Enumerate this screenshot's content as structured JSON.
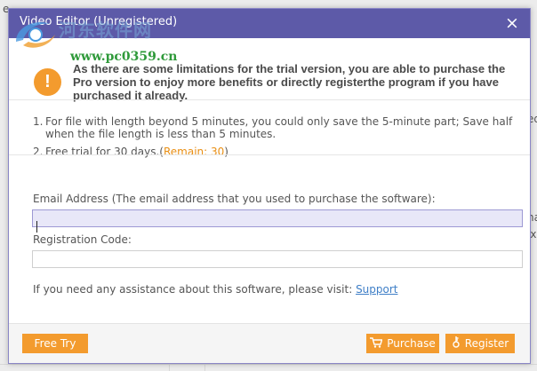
{
  "background": {
    "fragments": [
      "e",
      "ed",
      "na",
      "lx"
    ]
  },
  "dialog": {
    "title": "Video Editor (Unregistered)",
    "close_label": "×",
    "watermark": {
      "cn_text": "河东软件网",
      "url": "www.pc0359.cn"
    },
    "notice": "As there are some limitations for the trial version, you are able to purchase the Pro version to enjoy more benefits or directly registerthe program if you have purchased it already.",
    "notice_icon": "!",
    "limits": [
      {
        "num": "1.",
        "text": "For file with length beyond 5 minutes, you could only save the 5-minute part; Save half when the file length is less than 5 minutes."
      },
      {
        "num": "2.",
        "text": "Free trial for 30 days.",
        "remain_open": "(",
        "remain_label": "Remain: 30",
        "remain_close": ")"
      }
    ],
    "email": {
      "label": "Email Address (The email address that you used to purchase the software):",
      "value": "",
      "placeholder": ""
    },
    "code": {
      "label": "Registration Code:",
      "value": "",
      "placeholder": ""
    },
    "assist_text": "If you need any assistance about this software, please visit: ",
    "assist_link": "Support",
    "buttons": {
      "free_try": "Free Try",
      "purchase": "Purchase",
      "register": "Register"
    },
    "icons": {
      "purchase": "cart-icon",
      "register": "key-icon",
      "notice": "exclamation-icon",
      "close": "close-icon"
    },
    "colors": {
      "titlebar": "#5d5aa8",
      "accent": "#f39b2e",
      "link": "#3f7fc7",
      "remain": "#e98f14"
    }
  }
}
